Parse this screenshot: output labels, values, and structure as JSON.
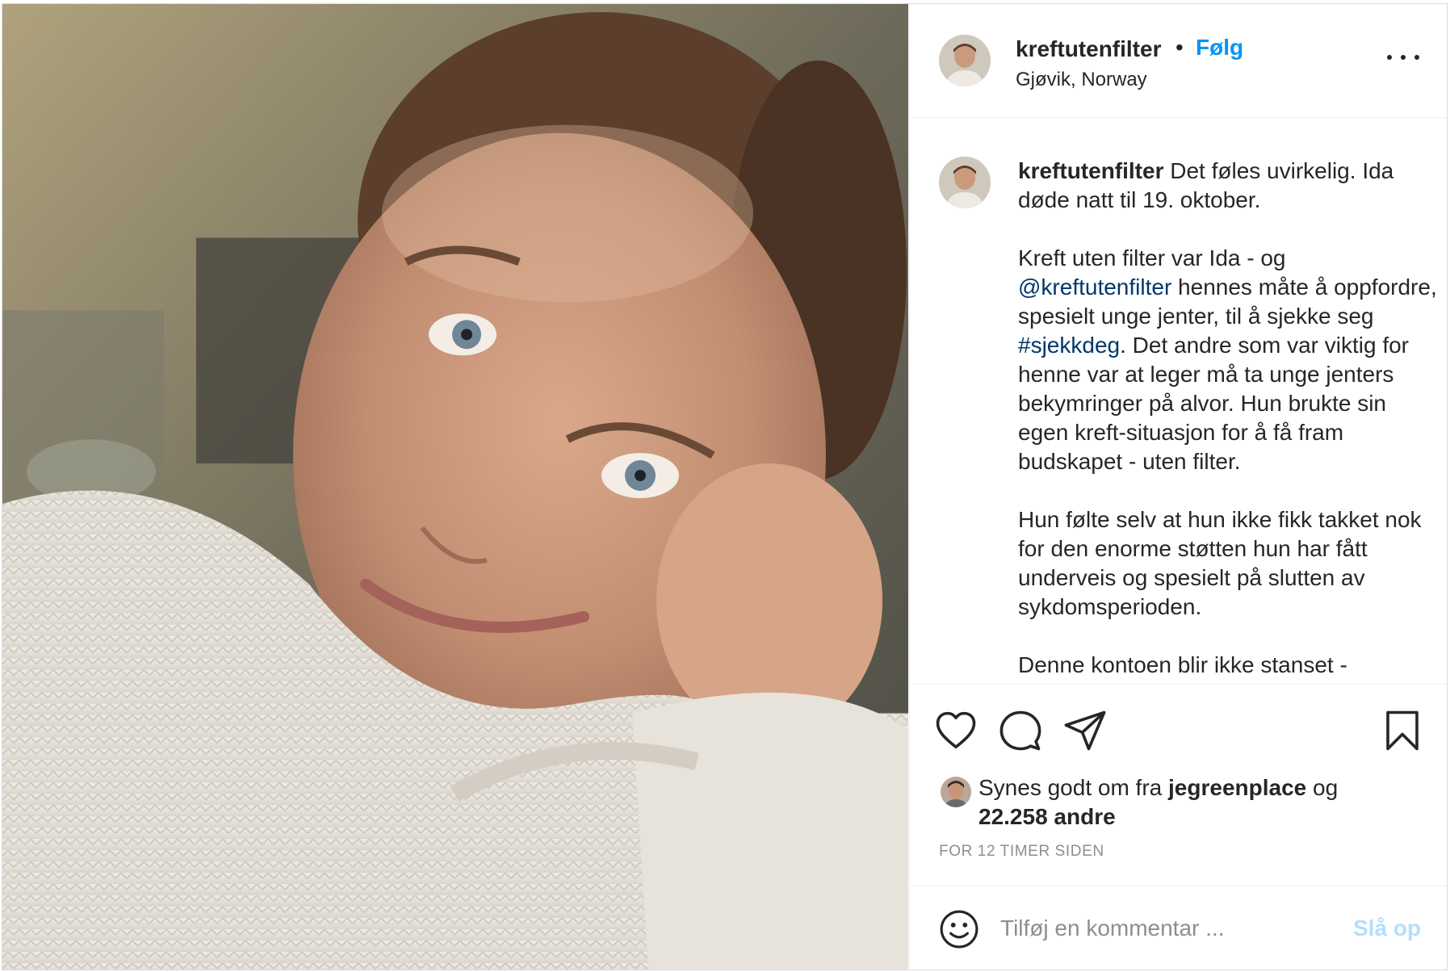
{
  "post": {
    "username": "kreftutenfilter",
    "follow_label": "Følg",
    "separator": "•",
    "location": "Gjøvik, Norway"
  },
  "caption": {
    "username": "kreftutenfilter",
    "p1_text": " Det føles uvirkelig. Ida døde natt til 19. oktober.",
    "p2_part1": "Kreft uten filter var Ida - og ",
    "p2_mention": "@kreftutenfilter",
    "p2_part2": " hennes måte å oppfordre, spesielt unge jenter, til å sjekke seg ",
    "p2_hashtag": "#sjekkdeg",
    "p2_part3": ". Det andre som var viktig for henne var at leger må ta unge jenters bekymringer på alvor. Hun brukte sin egen kreft-situasjon for å få fram budskapet - uten filter.",
    "p3": "Hun følte selv at hun ikke fikk takket nok for den enorme støtten hun har fått underveis og spesielt på slutten av sykdomsperioden.",
    "p4": "Denne kontoen blir ikke stanset -"
  },
  "likes": {
    "prefix": "Synes godt om fra ",
    "user": "jegreenplace",
    "middle": " og",
    "count": "22.258 andre"
  },
  "timestamp": "FOR 12 TIMER SIDEN",
  "comment_box": {
    "placeholder": "Tilføj en kommentar ...",
    "post_label": "Slå op"
  },
  "icons": [
    "heart-icon",
    "comment-icon",
    "share-icon",
    "bookmark-icon",
    "emoji-icon",
    "more-icon"
  ],
  "colors": {
    "link_blue": "#0095f6",
    "mention_blue": "#00376b",
    "disabled_blue": "#b2dffc",
    "text": "#262626",
    "muted": "#8e8e8e"
  }
}
